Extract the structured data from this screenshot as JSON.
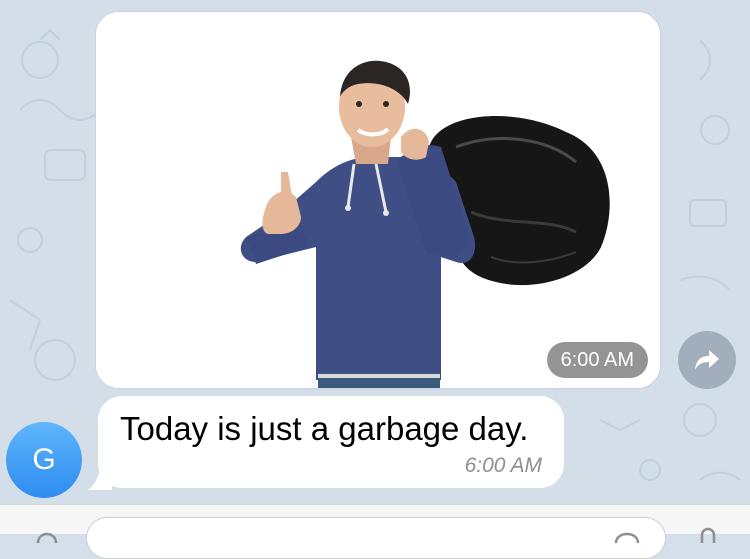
{
  "chat": {
    "photo_message": {
      "time": "6:00 AM"
    },
    "text_message": {
      "text": "Today is just a garbage day.",
      "time": "6:00 AM"
    },
    "sender": {
      "avatar_initial": "G",
      "avatar_color": "#3a96f3"
    }
  },
  "icons": {
    "share": "share-forward-icon",
    "attach": "attach-icon",
    "sticker": "sticker-icon",
    "mic": "microphone-icon"
  },
  "colors": {
    "wallpaper": "#d4dee9",
    "bubble": "#ffffff",
    "time_badge": "#5a5a5a",
    "avatar": "#3a96f3"
  }
}
